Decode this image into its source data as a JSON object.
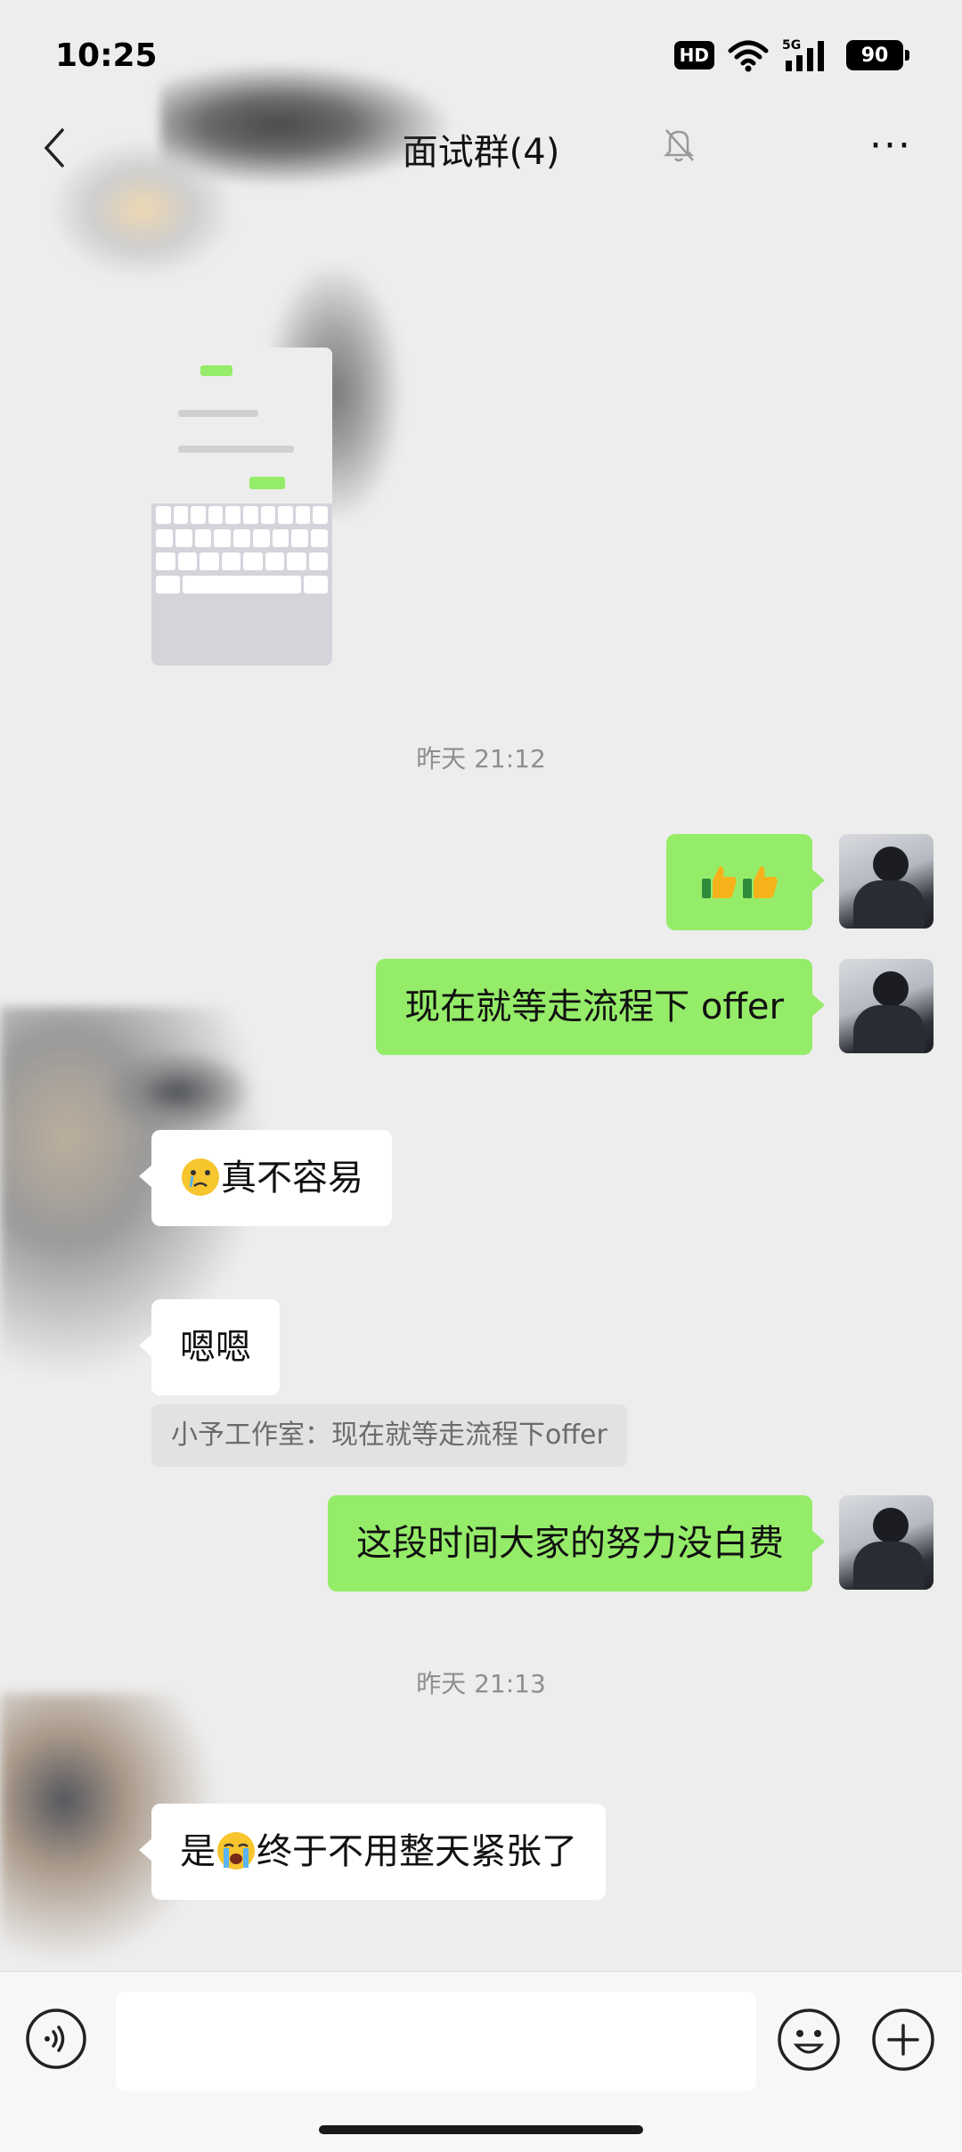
{
  "status_bar": {
    "time": "10:25",
    "hd_label": "HD",
    "network_label": "5G",
    "battery": "90"
  },
  "header": {
    "title": "面试群(4)",
    "back_icon": "chevron-left-icon",
    "mute_icon": "bell-muted-icon",
    "more_icon": "more-dots-icon"
  },
  "messages": [
    {
      "type": "image",
      "side": "left",
      "sender": "blurred",
      "content": "keyboard-screenshot"
    },
    {
      "type": "timestamp",
      "text": "昨天 21:12"
    },
    {
      "type": "emoji",
      "side": "right",
      "content": "thumbs-up x2"
    },
    {
      "type": "text",
      "side": "right",
      "text": "现在就等走流程下 offer"
    },
    {
      "type": "text",
      "side": "left",
      "emoji": "crying-face",
      "text": "真不容易"
    },
    {
      "type": "text",
      "side": "left",
      "text": "嗯嗯",
      "quote": "小予工作室：现在就等走流程下offer"
    },
    {
      "type": "text",
      "side": "right",
      "text": "这段时间大家的努力没白费"
    },
    {
      "type": "timestamp",
      "text": "昨天 21:13"
    },
    {
      "type": "text",
      "side": "left",
      "prefix": "是",
      "emoji": "loudly-crying-face",
      "text": "终于不用整天紧张了"
    }
  ],
  "input_bar": {
    "voice_icon": "voice-icon",
    "emoji_icon": "smiley-icon",
    "plus_icon": "plus-circle-icon",
    "placeholder": ""
  },
  "colors": {
    "background": "#ededed",
    "my_bubble": "#95ec69",
    "other_bubble": "#ffffff",
    "timestamp": "#8e8e8e"
  }
}
